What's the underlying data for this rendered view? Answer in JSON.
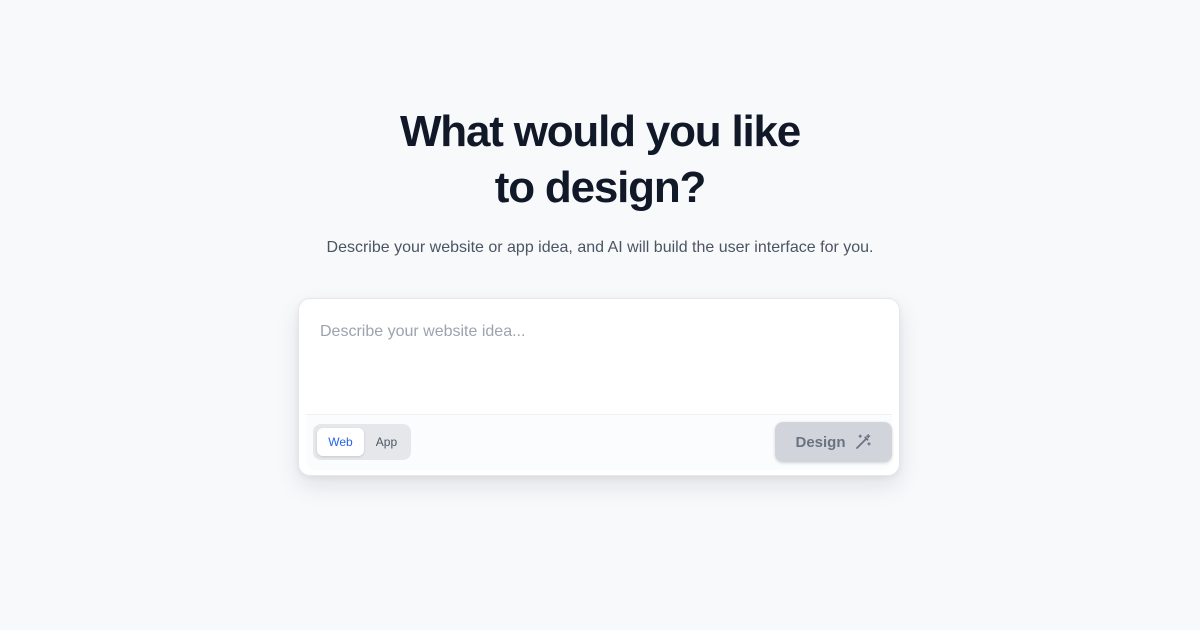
{
  "hero": {
    "title_line_1": "What would you like",
    "title_line_2": "to design?",
    "subtitle": "Describe your website or app idea, and AI will build the user interface for you."
  },
  "prompt": {
    "value": "",
    "placeholder": "Describe your website idea..."
  },
  "mode_toggle": {
    "options": [
      {
        "label": "Web",
        "selected": true
      },
      {
        "label": "App",
        "selected": false
      }
    ]
  },
  "actions": {
    "design_label": "Design",
    "design_icon": "magic-wand-icon",
    "disabled": true
  },
  "colors": {
    "background": "#f8f9fb",
    "heading": "#111827",
    "body_text": "#4b5563",
    "accent": "#2563eb",
    "disabled_button": "#d1d5db"
  }
}
